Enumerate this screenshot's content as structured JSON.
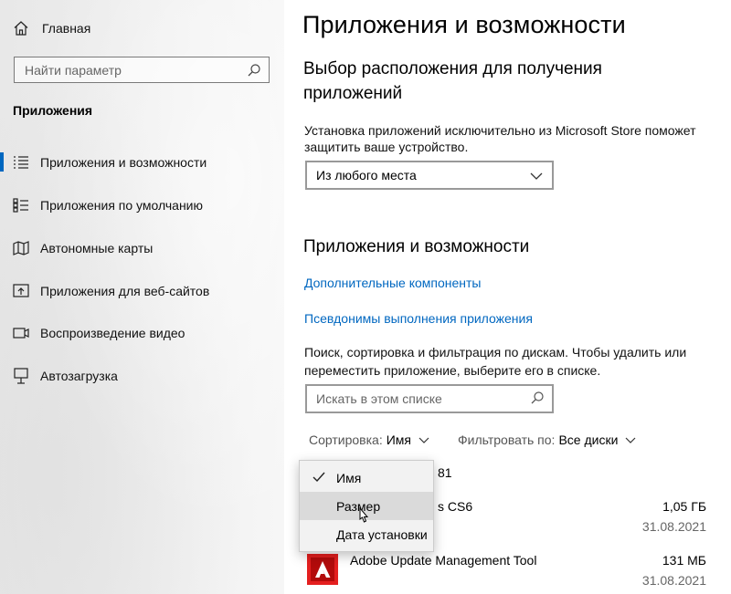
{
  "sidebar": {
    "home_label": "Главная",
    "search_placeholder": "Найти параметр",
    "section_title": "Приложения",
    "items": [
      {
        "label": "Приложения и возможности",
        "icon": "list-icon",
        "active": true
      },
      {
        "label": "Приложения по умолчанию",
        "icon": "default-apps-icon"
      },
      {
        "label": "Автономные карты",
        "icon": "map-icon"
      },
      {
        "label": "Приложения для веб-сайтов",
        "icon": "web-apps-icon"
      },
      {
        "label": "Воспроизведение видео",
        "icon": "video-icon"
      },
      {
        "label": "Автозагрузка",
        "icon": "startup-icon"
      }
    ]
  },
  "main": {
    "title": "Приложения и возможности",
    "install_heading_line1": "Выбор расположения для получения",
    "install_heading_line2": "приложений",
    "install_text_line1": "Установка приложений исключительно из Microsoft Store поможет",
    "install_text_line2": "защитить ваше устройство.",
    "install_dropdown_value": "Из любого места",
    "apps_heading": "Приложения и возможности",
    "link_optional": "Дополнительные компоненты",
    "link_aliases": "Псевдонимы выполнения приложения",
    "search_text_line1": "Поиск, сортировка и фильтрация по дискам. Чтобы удалить или",
    "search_text_line2": "переместить приложение, выберите его в списке.",
    "list_search_placeholder": "Искать в этом списке",
    "sort_label": "Сортировка:",
    "sort_value": "Имя",
    "filter_label": "Фильтровать по:",
    "filter_value": "Все диски",
    "apps": [
      {
        "name_visible": "81",
        "size": "",
        "date": ""
      },
      {
        "name_visible": "s CS6",
        "size": "1,05 ГБ",
        "date": "31.08.2021"
      },
      {
        "name": "Adobe Update Management Tool",
        "size": "131 МБ",
        "date": "31.08.2021"
      }
    ]
  },
  "sort_menu": {
    "items": [
      {
        "label": "Имя",
        "checked": true
      },
      {
        "label": "Размер",
        "hover": true
      },
      {
        "label": "Дата установки"
      }
    ]
  },
  "colors": {
    "accent": "#0067c0",
    "adobe_red": "#e41f1f"
  }
}
